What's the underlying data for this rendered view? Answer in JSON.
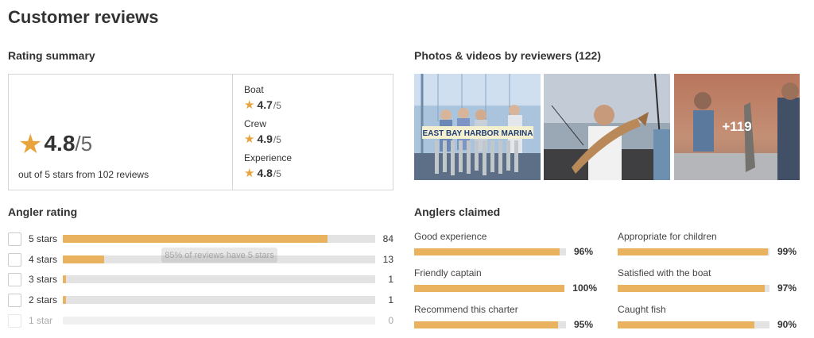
{
  "page": {
    "title": "Customer reviews"
  },
  "rating_summary": {
    "heading": "Rating summary",
    "overall": {
      "value": "4.8",
      "out_of": "/5",
      "subtitle": "out of 5 stars from 102 reviews"
    },
    "categories": [
      {
        "label": "Boat",
        "value": "4.7",
        "out_of": "/5"
      },
      {
        "label": "Crew",
        "value": "4.9",
        "out_of": "/5"
      },
      {
        "label": "Experience",
        "value": "4.8",
        "out_of": "/5"
      }
    ],
    "star_icon": "★",
    "star_color": "#e8a43b"
  },
  "photos": {
    "heading": "Photos & videos by reviewers (122)",
    "more_label": "+119",
    "sign_text": "EAST BAY HARBOR MARINA"
  },
  "angler_rating": {
    "heading": "Angler rating",
    "rows": [
      {
        "label": "5 stars",
        "count": "84",
        "fraction": 0.847
      },
      {
        "label": "4 stars",
        "count": "13",
        "fraction": 0.132
      },
      {
        "label": "3 stars",
        "count": "1",
        "fraction": 0.01
      },
      {
        "label": "2 stars",
        "count": "1",
        "fraction": 0.01
      },
      {
        "label": "1 star",
        "count": "0",
        "fraction": 0
      }
    ],
    "tooltip": "85% of reviews have 5 stars"
  },
  "anglers_claimed": {
    "heading": "Anglers claimed",
    "items": [
      {
        "label": "Good experience",
        "pct": "96%",
        "value": 96
      },
      {
        "label": "Appropriate for children",
        "pct": "99%",
        "value": 99
      },
      {
        "label": "Friendly captain",
        "pct": "100%",
        "value": 100
      },
      {
        "label": "Satisfied with the boat",
        "pct": "97%",
        "value": 97
      },
      {
        "label": "Recommend this charter",
        "pct": "95%",
        "value": 95
      },
      {
        "label": "Caught fish",
        "pct": "90%",
        "value": 90
      }
    ]
  },
  "colors": {
    "accent": "#e8b25e",
    "track": "#e3e3e3"
  }
}
